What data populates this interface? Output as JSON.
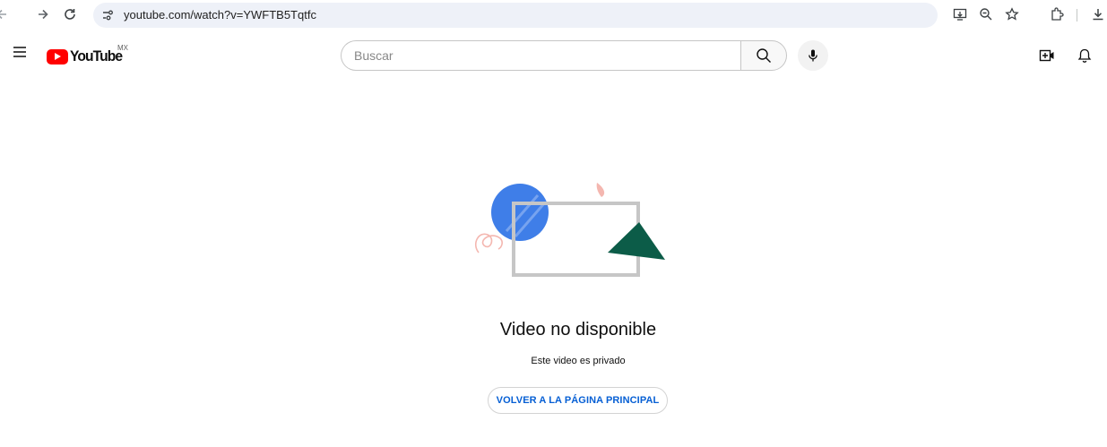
{
  "browser": {
    "url": "youtube.com/watch?v=YWFTB5Tqtfc",
    "icons": [
      "back-icon",
      "forward-icon",
      "reload-icon",
      "site-info-icon",
      "install-app-icon",
      "zoom-icon",
      "bookmark-star-icon",
      "extensions-icon",
      "downloads-icon"
    ]
  },
  "masthead": {
    "logo_text": "YouTube",
    "country_code": "MX",
    "search_placeholder": "Buscar",
    "search_value": "",
    "icons": [
      "menu-icon",
      "search-icon",
      "mic-icon",
      "create-icon",
      "notifications-icon"
    ]
  },
  "content": {
    "title": "Video no disponible",
    "subtitle": "Este video es privado",
    "home_button": "VOLVER A LA PÁGINA PRINCIPAL"
  },
  "colors": {
    "accent_link": "#065fd4",
    "yt_red": "#ff0000",
    "illustration_blue": "#3f7ee8",
    "illustration_green": "#0c5c48",
    "illustration_pink": "#f4b7b0"
  }
}
